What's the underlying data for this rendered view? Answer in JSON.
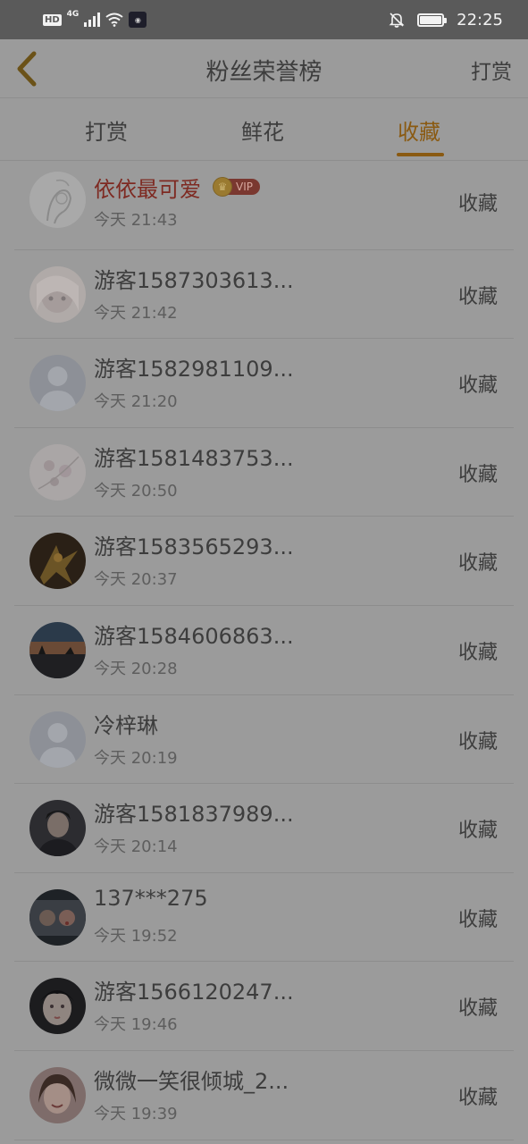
{
  "status_bar": {
    "hd": "HD",
    "network": "4G",
    "time": "22:25",
    "icons": [
      "signal-icon",
      "wifi-icon",
      "app-icon",
      "mute-bell-icon",
      "battery-icon"
    ]
  },
  "header": {
    "title": "粉丝荣誉榜",
    "action": "打赏",
    "back_icon": "back-chevron-icon"
  },
  "tabs": [
    {
      "label": "打赏",
      "active": false
    },
    {
      "label": "鲜花",
      "active": false
    },
    {
      "label": "收藏",
      "active": true
    }
  ],
  "colors": {
    "accent": "#8a5a12",
    "vip_name": "#7e2a22",
    "statusbar": "#5a5a5a",
    "background": "#9b9b9b"
  },
  "list": [
    {
      "name": "依依最可爱",
      "time": "今天 21:43",
      "action": "收藏",
      "vip": true,
      "vip_label": "VIP",
      "avatar": "sketch-girl-avatar"
    },
    {
      "name": "游客1587303613...",
      "time": "今天 21:42",
      "action": "收藏",
      "vip": false,
      "avatar": "anime-girl-avatar"
    },
    {
      "name": "游客1582981109...",
      "time": "今天 21:20",
      "action": "收藏",
      "vip": false,
      "avatar": "default-user-avatar"
    },
    {
      "name": "游客1581483753...",
      "time": "今天 20:50",
      "action": "收藏",
      "vip": false,
      "avatar": "flower-avatar"
    },
    {
      "name": "游客1583565293...",
      "time": "今天 20:37",
      "action": "收藏",
      "vip": false,
      "avatar": "dancer-avatar"
    },
    {
      "name": "游客1584606863...",
      "time": "今天 20:28",
      "action": "收藏",
      "vip": false,
      "avatar": "sunset-avatar"
    },
    {
      "name": "冷梓琳",
      "time": "今天 20:19",
      "action": "收藏",
      "vip": false,
      "avatar": "default-user-avatar"
    },
    {
      "name": "游客1581837989...",
      "time": "今天 20:14",
      "action": "收藏",
      "vip": false,
      "avatar": "boy-photo-avatar"
    },
    {
      "name": "137***275",
      "time": "今天 19:52",
      "action": "收藏",
      "vip": false,
      "avatar": "movie-still-avatar"
    },
    {
      "name": "游客1566120247...",
      "time": "今天 19:46",
      "action": "收藏",
      "vip": false,
      "avatar": "girl-face-avatar"
    },
    {
      "name": "微微一笑很倾城_2...",
      "time": "今天 19:39",
      "action": "收藏",
      "vip": false,
      "avatar": "smiling-girl-avatar"
    }
  ]
}
